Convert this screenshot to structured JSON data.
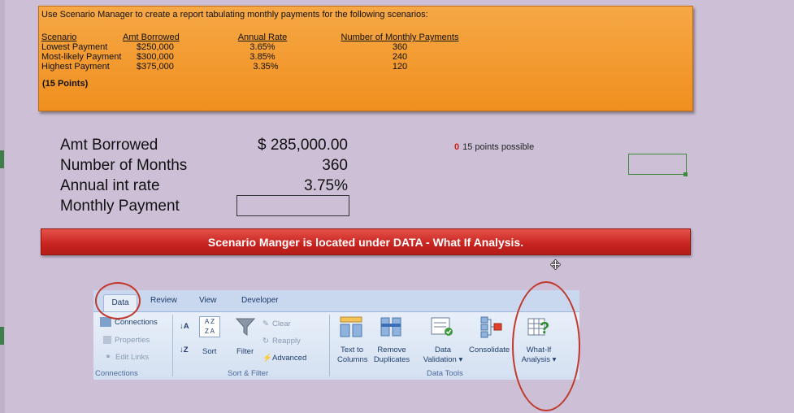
{
  "instructions": {
    "title": "Use Scenario Manager to create a report tabulating monthly payments for the following scenarios:",
    "headers": {
      "scenario": "Scenario",
      "amt_borrowed": "Amt Borrowed",
      "annual_rate": "Annual Rate",
      "num_payments": "Number of Monthly Payments"
    },
    "rows": [
      {
        "scenario": "Lowest Payment",
        "amt": "$250,000",
        "rate": "3.65%",
        "payments": "360"
      },
      {
        "scenario": "Most-likely Payment",
        "amt": "$300,000",
        "rate": "3.85%",
        "payments": "240"
      },
      {
        "scenario": "Highest Payment",
        "amt": "$375,000",
        "rate": "3.35%",
        "payments": "120"
      }
    ],
    "points": "(15 Points)"
  },
  "worksheet": {
    "amt_borrowed_label": "Amt Borrowed",
    "amt_borrowed_value": "$ 285,000.00",
    "months_label": "Number of Months",
    "months_value": "360",
    "rate_label": "Annual int rate",
    "rate_value": "3.75%",
    "payment_label": "Monthly Payment",
    "payment_value": ""
  },
  "score": {
    "value": "0",
    "text": "15 points possible"
  },
  "banner": {
    "text": "Scenario Manger is located under DATA - What If Analysis."
  },
  "ribbon": {
    "tabs": [
      "Data",
      "Review",
      "View",
      "Developer"
    ],
    "connections": {
      "connections": "Connections",
      "properties": "Properties",
      "edit_links": "Edit Links",
      "group": "Connections"
    },
    "sort_filter": {
      "sort": "Sort",
      "filter": "Filter",
      "clear": "Clear",
      "reapply": "Reapply",
      "advanced": "Advanced",
      "group": "Sort & Filter"
    },
    "data_tools": {
      "text_to_columns_1": "Text to",
      "text_to_columns_2": "Columns",
      "remove_duplicates_1": "Remove",
      "remove_duplicates_2": "Duplicates",
      "data_validation_1": "Data",
      "data_validation_2": "Validation ▾",
      "consolidate": "Consolidate",
      "what_if_1": "What-If",
      "what_if_2": "Analysis ▾",
      "group": "Data Tools"
    }
  },
  "colors": {
    "orange": "#f08f1f",
    "banner_red": "#c7231f",
    "annotation_red": "#c0392b",
    "selection_green": "#3b8a3b"
  }
}
